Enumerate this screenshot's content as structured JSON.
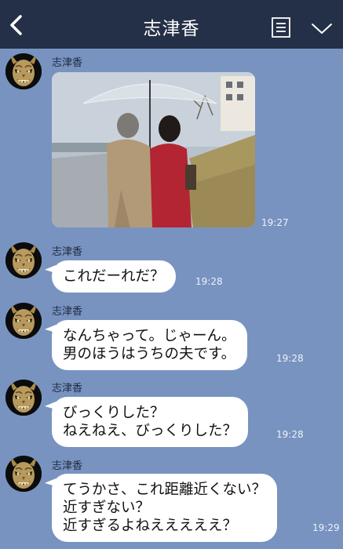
{
  "header": {
    "title": "志津香"
  },
  "messages": [
    {
      "sender": "志津香",
      "type": "image",
      "time": "19:27"
    },
    {
      "sender": "志津香",
      "type": "text",
      "lines": [
        "これだーれだ？"
      ],
      "time": "19:28"
    },
    {
      "sender": "志津香",
      "type": "text",
      "lines": [
        "なんちゃって。じゃーん。",
        "男のほうはうちの夫です。"
      ],
      "time": "19:28"
    },
    {
      "sender": "志津香",
      "type": "text",
      "lines": [
        "びっくりした？",
        "ねえねえ、びっくりした？"
      ],
      "time": "19:28"
    },
    {
      "sender": "志津香",
      "type": "text",
      "lines": [
        "てうかさ、これ距離近くない？",
        "近すぎない？",
        "近すぎるよねえええええ？"
      ],
      "time": "19:29"
    }
  ],
  "icons": {
    "back": "back-chevron-icon",
    "menu": "note-list-icon",
    "more": "chevron-down-icon",
    "avatar": "hannya-mask-avatar"
  },
  "colors": {
    "header_bg": "#243047",
    "chat_bg": "#7893c0",
    "bubble_bg": "#ffffff"
  }
}
